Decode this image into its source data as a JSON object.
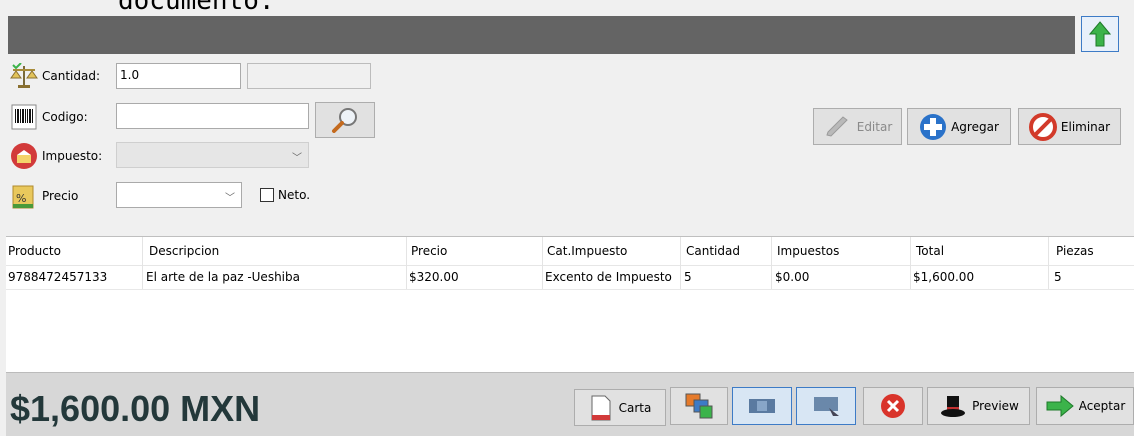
{
  "top_fragment": "documento.",
  "form": {
    "cantidad": {
      "label": "Cantidad:",
      "value": "1.0",
      "secondary_value": ""
    },
    "codigo": {
      "label": "Codigo:",
      "value": ""
    },
    "impuesto": {
      "label": "Impuesto:",
      "selected": ""
    },
    "precio": {
      "label": "Precio",
      "selected": "",
      "neto_label": "Neto.",
      "neto_checked": false
    }
  },
  "actions": {
    "editar": "Editar",
    "agregar": "Agregar",
    "eliminar": "Eliminar"
  },
  "table": {
    "columns": [
      "Producto",
      "Descripcion",
      "Precio",
      "Cat.Impuesto",
      "Cantidad",
      "Impuestos",
      "Total",
      "Piezas"
    ],
    "rows": [
      [
        "9788472457133",
        "El arte de la paz -Ueshiba",
        "$320.00",
        "Excento de Impuesto",
        "5",
        "$0.00",
        "$1,600.00",
        "5"
      ]
    ]
  },
  "footer": {
    "total": "$1,600.00 MXN",
    "carta": "Carta",
    "preview": "Preview",
    "aceptar": "Aceptar"
  },
  "colors": {
    "title_bar": "#646464",
    "total_text": "#23383a",
    "accent_blue": "#3d7bc6",
    "green": "#3bb34a",
    "red": "#d9342b"
  },
  "icons": [
    "scale-icon",
    "barcode-icon",
    "tax-icon",
    "price-tag-icon",
    "magnifier-icon",
    "pencil-icon",
    "plus-icon",
    "no-entry-icon",
    "up-arrow-icon",
    "document-icon",
    "images-icon",
    "panel-icon",
    "screen-icon",
    "close-circle-icon",
    "top-hat-icon",
    "right-arrow-icon"
  ]
}
